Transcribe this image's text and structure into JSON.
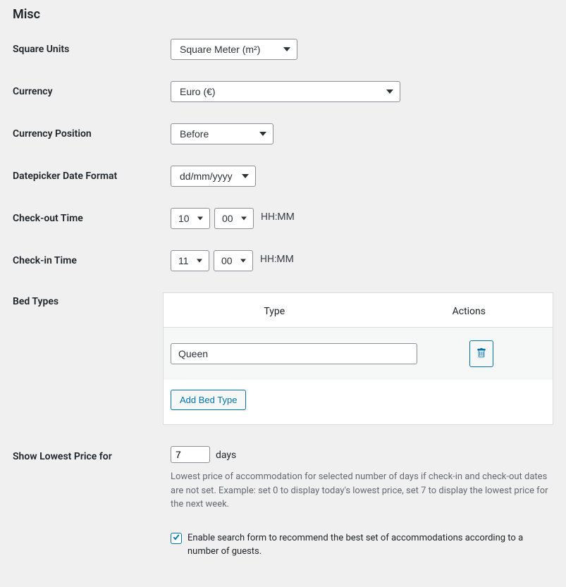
{
  "sectionTitle": "Misc",
  "squareUnits": {
    "label": "Square Units",
    "value": "Square Meter (m²)"
  },
  "currency": {
    "label": "Currency",
    "value": "Euro (€)"
  },
  "currencyPosition": {
    "label": "Currency Position",
    "value": "Before"
  },
  "dateFormat": {
    "label": "Datepicker Date Format",
    "value": "dd/mm/yyyy"
  },
  "checkoutTime": {
    "label": "Check-out Time",
    "hour": "10",
    "minute": "00",
    "hint": "HH:MM"
  },
  "checkinTime": {
    "label": "Check-in Time",
    "hour": "11",
    "minute": "00",
    "hint": "HH:MM"
  },
  "bedTypes": {
    "label": "Bed Types",
    "headerType": "Type",
    "headerActions": "Actions",
    "rows": [
      {
        "value": "Queen"
      }
    ],
    "addButton": "Add Bed Type"
  },
  "lowestPrice": {
    "label": "Show Lowest Price for",
    "value": "7",
    "unit": "days",
    "description": "Lowest price of accommodation for selected number of days if check-in and check-out dates are not set. Example: set 0 to display today's lowest price, set 7 to display the lowest price for the next week."
  },
  "recommendCheckbox": {
    "checked": true,
    "label": "Enable search form to recommend the best set of accommodations according to a number of guests."
  }
}
